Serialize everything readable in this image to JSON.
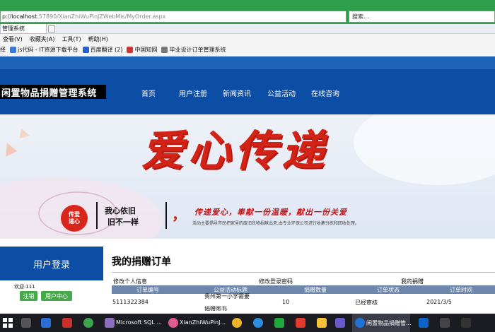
{
  "browser": {
    "address_prefix": "p://",
    "address_host": "localhost",
    "address_path": ":57890/XianZhiWuPinJZWebMis/MyOrder.aspx",
    "search_placeholder": "搜索...",
    "tab_title": "管理系统",
    "menu": [
      "查看(V)",
      "收藏夹(A)",
      "工具(T)",
      "帮助(H)"
    ],
    "favorites": [
      "择",
      "js代码 - IT资源下载平台",
      "百度翻译 (2)",
      "中国知网",
      "毕业设计订单管理系统"
    ]
  },
  "site": {
    "title": "闲置物品捐赠管理系统",
    "nav": [
      "首页",
      "用户注册",
      "新闻资讯",
      "公益活动",
      "在线咨询"
    ]
  },
  "banner": {
    "headline": "爱心传递",
    "badge": "传爱\n递心",
    "box_line1": "我心依旧",
    "box_line2": "旧不一样",
    "comma": "，",
    "slogan": "传递爱心，奉献一份温暖，献出一份关爱",
    "subtext": "活动主要倡导市民把家里的废旧衣物捐献出来,由专业环保公司进行收集分拣和回收处理。"
  },
  "sidebar": {
    "login_title": "用户登录",
    "welcome": "欢迎:111",
    "logout": "注销",
    "user_center": "用户中心"
  },
  "content": {
    "title": "我的捐赠订单",
    "tabs": [
      "修改个人信息",
      "修改登录密码",
      "我的捐赠"
    ],
    "columns": [
      "订单编号",
      "公益活动标题",
      "捐赠数量",
      "订单状态",
      "订单时间"
    ],
    "rows": [
      {
        "id": "5111322384",
        "activity_line1": "贵州第一小学需要",
        "activity_line2": "捐赠图书",
        "qty": "10",
        "status": "已经审核",
        "date": "2021/3/5"
      }
    ]
  },
  "taskbar": {
    "apps": [
      "Microsoft SQL ...",
      "XianZhiWuPinJ...",
      "闲置物品捐赠管..."
    ]
  },
  "colors": {
    "browser_green": "#2f9e4a",
    "header_blue": "#0c4da6",
    "banner_red": "#d32316",
    "button_green": "#47a84a",
    "table_head": "#6c86ac"
  }
}
